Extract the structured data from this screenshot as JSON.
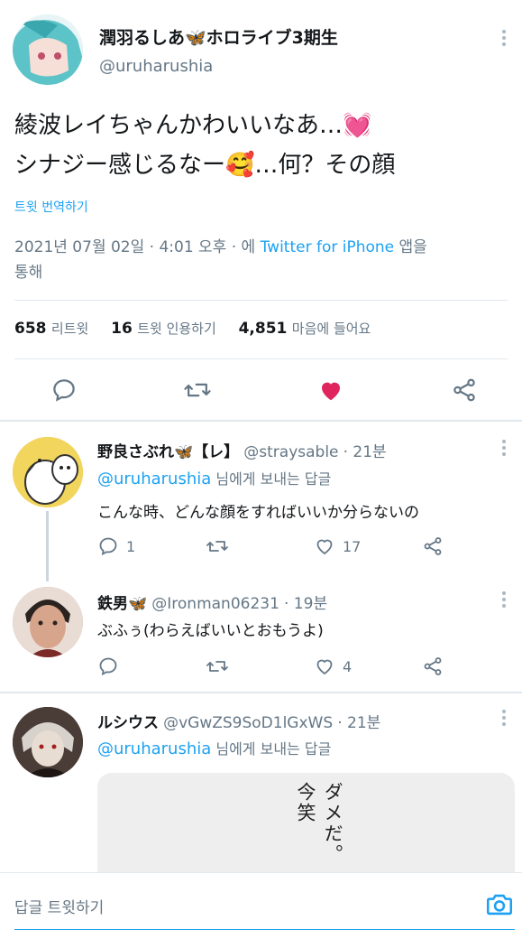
{
  "main_tweet": {
    "display_name": "潤羽るしあ🦋ホロライブ3期生",
    "handle": "@uruharushia",
    "text_line1": "綾波レイちゃんかわいいなあ…💓",
    "text_line2": "シナジー感じるなー🥰…何？その顔",
    "translate_label": "트윗 번역하기",
    "meta_line1_pre": "2021년 07월 02일 · 4:01 오후 · 에 ",
    "meta_source": "Twitter for iPhone",
    "meta_line1_post": " 앱을",
    "meta_line2": "통해",
    "retweets": "658",
    "retweets_label": "리트윗",
    "quotes": "16",
    "quotes_label": "트윗 인용하기",
    "likes": "4,851",
    "likes_label": "마음에 들어요"
  },
  "replies": [
    {
      "display_name": "野良さぶれ🦋【レ】",
      "handle": "@straysable",
      "time": "· 21분",
      "reply_to_mention": "@uruharushia",
      "reply_to_suffix": " 님에게 보내는 답글",
      "text": "こんな時、どんな顔をすればいいか分らないの",
      "reply_count": "1",
      "like_count": "17"
    },
    {
      "display_name": "鉄男🦋",
      "handle": "@Ironman06231",
      "time": "· 19분",
      "text": "ぶふぅ(わらえばいいとおもうよ)",
      "like_count": "4"
    },
    {
      "display_name": "ルシウス",
      "handle": "@vGwZS9SoD1lGxWS",
      "time": "· 21분",
      "reply_to_mention": "@uruharushia",
      "reply_to_suffix": " 님에게 보내는 답글",
      "image_text": "ダメだ。今笑"
    }
  ],
  "composer": {
    "placeholder": "답글 트윗하기"
  },
  "colors": {
    "accent": "#1da1f2",
    "like": "#e0245e",
    "text": "#14171a",
    "muted": "#657786"
  }
}
